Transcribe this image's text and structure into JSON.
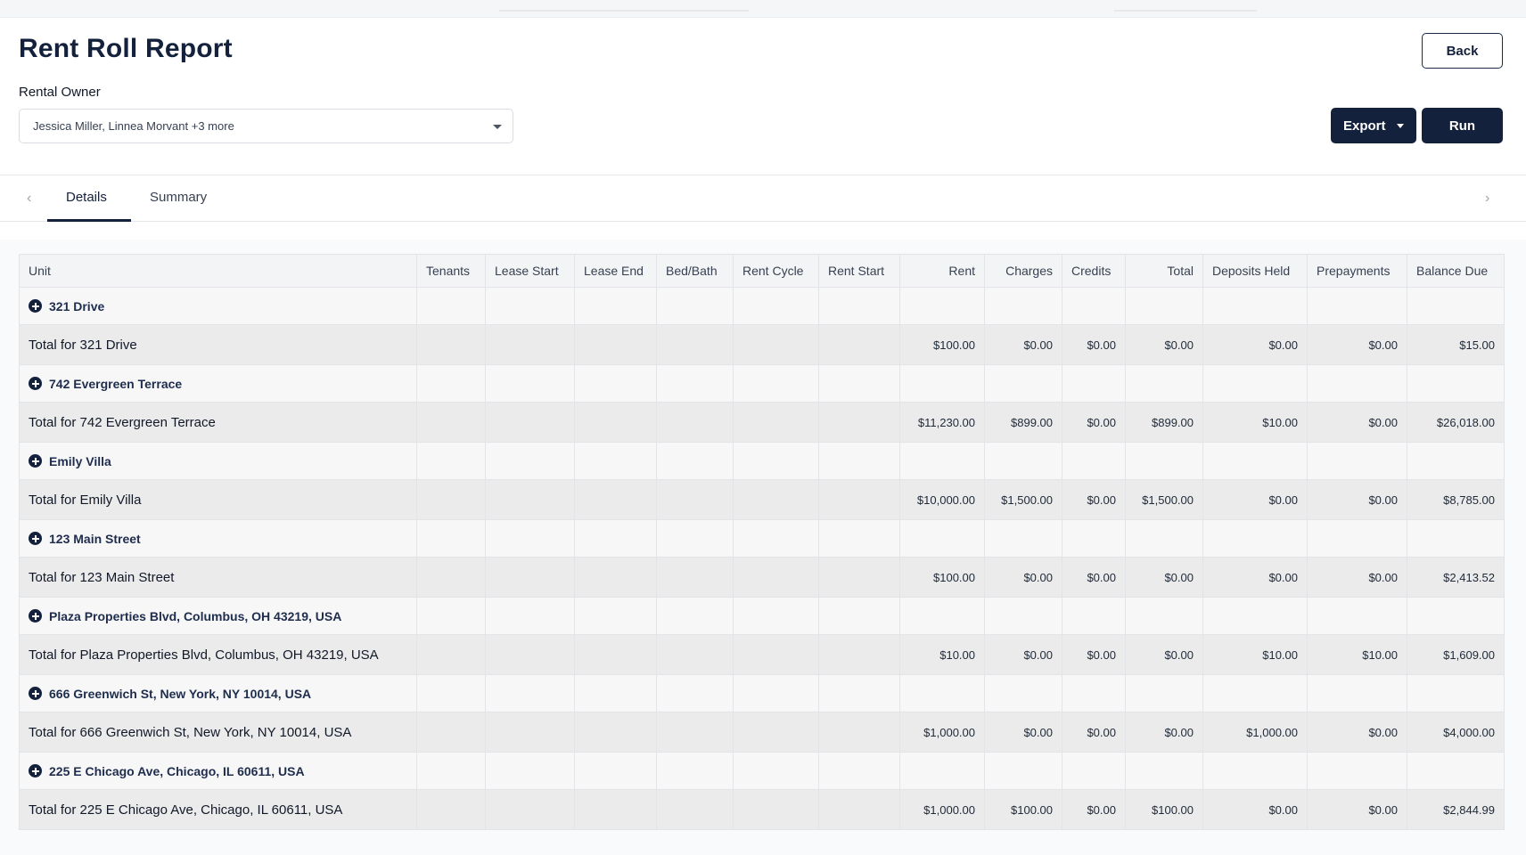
{
  "header": {
    "title": "Rent Roll Report",
    "back_label": "Back"
  },
  "filters": {
    "owner_label": "Rental Owner",
    "owner_value": "Jessica Miller, Linnea Morvant +3 more"
  },
  "actions": {
    "export_label": "Export",
    "run_label": "Run"
  },
  "tabs": {
    "prev_arrow": "‹",
    "next_arrow": "›",
    "items": [
      {
        "label": "Details",
        "active": true
      },
      {
        "label": "Summary",
        "active": false
      }
    ]
  },
  "table": {
    "columns": [
      "Unit",
      "Tenants",
      "Lease Start",
      "Lease End",
      "Bed/Bath",
      "Rent Cycle",
      "Rent Start",
      "Rent",
      "Charges",
      "Credits",
      "Total",
      "Deposits Held",
      "Prepayments",
      "Balance Due"
    ],
    "groups": [
      {
        "name": "321 Drive",
        "total_label": "Total for 321 Drive",
        "rent": "$100.00",
        "charges": "$0.00",
        "credits": "$0.00",
        "total": "$0.00",
        "deposits": "$0.00",
        "prepayments": "$0.00",
        "balance": "$15.00"
      },
      {
        "name": "742 Evergreen Terrace",
        "total_label": "Total for 742 Evergreen Terrace",
        "rent": "$11,230.00",
        "charges": "$899.00",
        "credits": "$0.00",
        "total": "$899.00",
        "deposits": "$10.00",
        "prepayments": "$0.00",
        "balance": "$26,018.00"
      },
      {
        "name": "Emily Villa",
        "total_label": "Total for Emily Villa",
        "rent": "$10,000.00",
        "charges": "$1,500.00",
        "credits": "$0.00",
        "total": "$1,500.00",
        "deposits": "$0.00",
        "prepayments": "$0.00",
        "balance": "$8,785.00"
      },
      {
        "name": "123 Main Street",
        "total_label": "Total for 123 Main Street",
        "rent": "$100.00",
        "charges": "$0.00",
        "credits": "$0.00",
        "total": "$0.00",
        "deposits": "$0.00",
        "prepayments": "$0.00",
        "balance": "$2,413.52"
      },
      {
        "name": "Plaza Properties Blvd, Columbus, OH 43219, USA",
        "total_label": "Total for Plaza Properties Blvd, Columbus, OH 43219, USA",
        "rent": "$10.00",
        "charges": "$0.00",
        "credits": "$0.00",
        "total": "$0.00",
        "deposits": "$10.00",
        "prepayments": "$10.00",
        "balance": "$1,609.00"
      },
      {
        "name": "666 Greenwich St, New York, NY 10014, USA",
        "total_label": "Total for 666 Greenwich St, New York, NY 10014, USA",
        "rent": "$1,000.00",
        "charges": "$0.00",
        "credits": "$0.00",
        "total": "$0.00",
        "deposits": "$1,000.00",
        "prepayments": "$0.00",
        "balance": "$4,000.00"
      },
      {
        "name": "225 E Chicago Ave, Chicago, IL 60611, USA",
        "total_label": "Total for 225 E Chicago Ave, Chicago, IL 60611, USA",
        "rent": "$1,000.00",
        "charges": "$100.00",
        "credits": "$0.00",
        "total": "$100.00",
        "deposits": "$0.00",
        "prepayments": "$0.00",
        "balance": "$2,844.99"
      }
    ]
  },
  "colors": {
    "primary": "#14213d",
    "header_bg": "#f3f4f6",
    "total_row_bg": "#ebebec"
  }
}
